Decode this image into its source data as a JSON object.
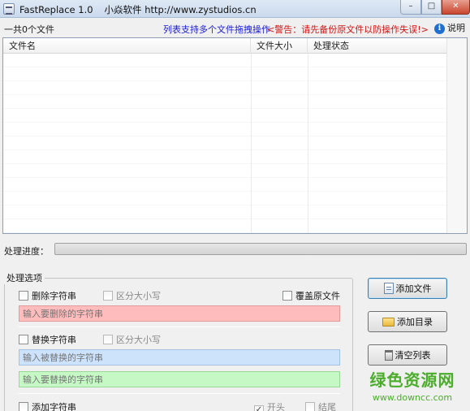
{
  "window": {
    "title": "FastReplace 1.0",
    "subtitle": "小焱软件 http://www.zystudios.cn",
    "minimize_glyph": "–",
    "maximize_glyph": "□",
    "close_glyph": "✕"
  },
  "info": {
    "file_count": "一共0个文件",
    "drag_hint": "列表支持多个文件拖拽操作",
    "warning": "<警告：请先备份原文件以防操作失误!>",
    "help_glyph": "i",
    "help_label": "说明"
  },
  "file_list": {
    "columns": [
      "文件名",
      "文件大小",
      "处理状态"
    ],
    "rows": []
  },
  "progress": {
    "label": "处理进度：",
    "percent": 0
  },
  "options": {
    "group_title": "处理选项",
    "delete": {
      "label": "删除字符串",
      "case_label": "区分大小写",
      "placeholder": "输入要删除的字符串",
      "checked": false
    },
    "overwrite": {
      "label": "覆盖原文件",
      "checked": false
    },
    "replace": {
      "label": "替换字符串",
      "case_label": "区分大小写",
      "find_placeholder": "输入被替换的字符串",
      "replace_placeholder": "输入要替换的字符串",
      "checked": false
    },
    "add": {
      "label": "添加字符串",
      "start_label": "开头",
      "end_label": "结尾",
      "checked": false,
      "start_checked": true,
      "check_glyph": "✓"
    }
  },
  "buttons": {
    "add_file": "添加文件",
    "add_folder": "添加目录",
    "clear_list": "清空列表"
  },
  "watermark": {
    "text": "绿色资源网",
    "url": "www.downcc.com"
  }
}
